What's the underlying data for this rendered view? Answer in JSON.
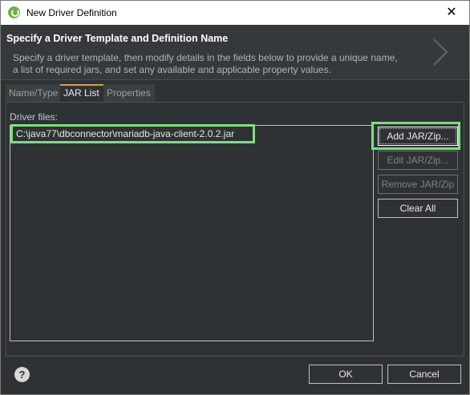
{
  "window": {
    "title": "New Driver Definition",
    "close_glyph": "✕"
  },
  "header": {
    "title": "Specify a Driver Template and Definition Name",
    "description": "Specify a driver template, then modify details in the fields below to provide a unique name, a list of required jars, and set any available and applicable property values."
  },
  "tabs": [
    {
      "label": "Name/Type"
    },
    {
      "label": "JAR List"
    },
    {
      "label": "Properties"
    }
  ],
  "jar_list": {
    "label": "Driver files:",
    "files": [
      "C:\\java77\\dbconnector\\mariadb-java-client-2.0.2.jar"
    ]
  },
  "buttons": {
    "add_jar": "Add JAR/Zip...",
    "edit_jar": "Edit JAR/Zip...",
    "remove_jar": "Remove JAR/Zip",
    "clear_all": "Clear All"
  },
  "footer": {
    "ok": "OK",
    "cancel": "Cancel",
    "help_glyph": "?"
  },
  "colors": {
    "background": "#2f3235",
    "highlight": "#7ddf7d",
    "active_tab_accent": "#c7a74d"
  }
}
